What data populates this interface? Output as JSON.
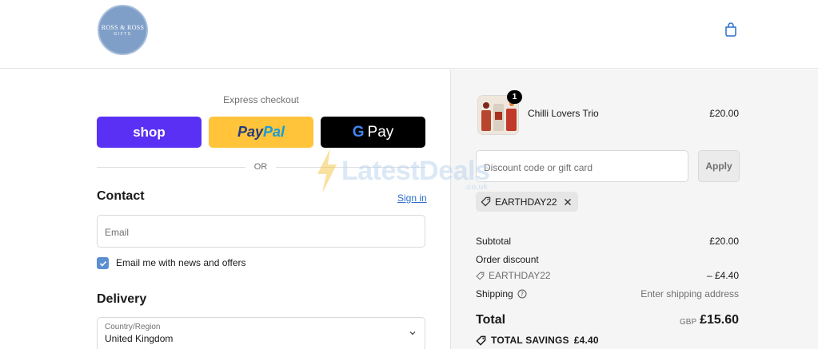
{
  "header": {
    "logo_line1": "ROSS & ROSS",
    "logo_line2": "GIFTS",
    "cart_icon": "shopping-bag-icon"
  },
  "express": {
    "title": "Express checkout",
    "shop_label": "shop",
    "paypal_part1": "Pay",
    "paypal_part2": "Pal",
    "gpay_g": "G",
    "gpay_label": "Pay",
    "or_label": "OR"
  },
  "contact": {
    "title": "Contact",
    "signin_label": "Sign in",
    "email_placeholder": "Email",
    "newsletter_label": "Email me with news and offers",
    "newsletter_checked": true
  },
  "delivery": {
    "title": "Delivery",
    "country_label": "Country/Region",
    "country_value": "United Kingdom"
  },
  "order": {
    "product_name": "Chilli Lovers Trio",
    "product_price": "£20.00",
    "quantity": "1",
    "discount_placeholder": "Discount code or gift card",
    "apply_label": "Apply",
    "applied_code": "EARTHDAY22",
    "subtotal_label": "Subtotal",
    "subtotal_value": "£20.00",
    "order_discount_label": "Order discount",
    "discount_code": "EARTHDAY22",
    "discount_value": "– £4.40",
    "shipping_label": "Shipping",
    "shipping_value": "Enter shipping address",
    "total_label": "Total",
    "total_currency": "GBP",
    "total_value": "£15.60",
    "savings_label": "TOTAL SAVINGS",
    "savings_value": "£4.40"
  },
  "watermark": {
    "text": "LatestDeals",
    "sub": ".co.uk"
  },
  "colors": {
    "shop_brand": "#5a31f4",
    "paypal_brand": "#ffc439",
    "gpay_brand": "#000000",
    "link": "#2c6ecb",
    "summary_bg": "#f5f5f5"
  }
}
